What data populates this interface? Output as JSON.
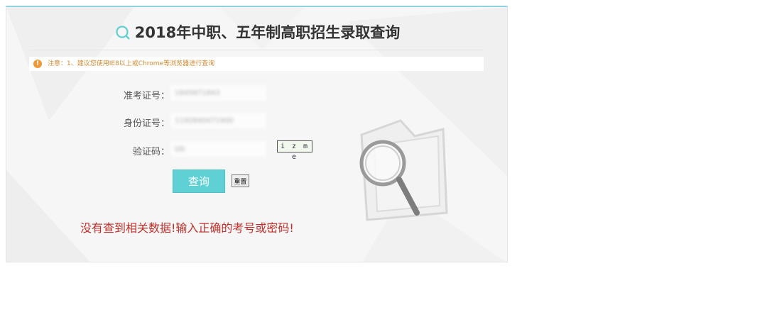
{
  "page": {
    "title": "2018年中职、五年制高职招生录取查询",
    "notice": "注意：1、建议您使用IE8以上或Chrome等浏览器进行查询",
    "notice_icon": "warning-icon"
  },
  "form": {
    "exam_no_label": "准考证号：",
    "exam_no_value": "1845871843",
    "id_no_label": "身份证号：",
    "id_no_value": "1192840471900",
    "captcha_label": "验证码：",
    "captcha_value": "lzb",
    "captcha_image_text": "i z m e"
  },
  "buttons": {
    "query_label": "查询",
    "reset_label": "重置"
  },
  "result": {
    "error_message": "没有查到相关数据!输入正确的考号或密码!"
  },
  "colors": {
    "accent": "#5fd0d3",
    "error": "#c0302a",
    "notice": "#d7892f"
  }
}
